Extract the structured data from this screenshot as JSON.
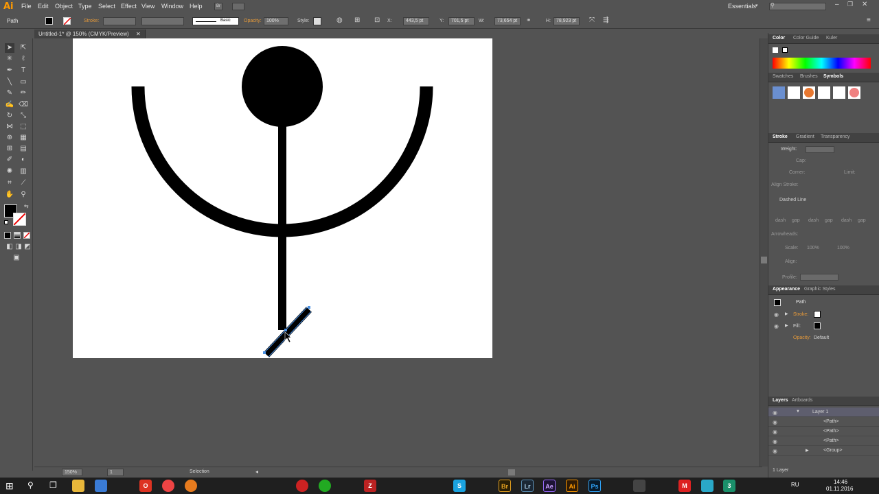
{
  "app": {
    "logo": "Ai",
    "workspace": "Essentials"
  },
  "menu": [
    "File",
    "Edit",
    "Object",
    "Type",
    "Select",
    "Effect",
    "View",
    "Window",
    "Help"
  ],
  "bridge_label": "Br",
  "control": {
    "selection_label": "Path",
    "stroke_label": "Stroke:",
    "brush_label": "Basic",
    "opacity_label": "Opacity:",
    "opacity_value": "100%",
    "style_label": "Style:",
    "x_label": "X:",
    "x_value": "443,5 pt",
    "y_label": "Y:",
    "y_value": "701,5 pt",
    "w_label": "W:",
    "w_value": "73,654 pt",
    "h_label": "H:",
    "h_value": "78,923 pt"
  },
  "document_tab": "Untitled-1* @ 150% (CMYK/Preview)",
  "status": {
    "zoom": "150%",
    "artboard": "1",
    "tool": "Selection"
  },
  "panels": {
    "color_tabs": [
      "Color",
      "Color Guide",
      "Kuler"
    ],
    "symbol_tabs": [
      "Swatches",
      "Brushes",
      "Symbols"
    ],
    "stroke_tabs": [
      "Stroke",
      "Gradient",
      "Transparency"
    ],
    "stroke": {
      "weight": "Weight:",
      "cap": "Cap:",
      "corner": "Corner:",
      "limit": "Limit:",
      "align": "Align Stroke:",
      "dashed": "Dashed Line",
      "dash_labels": [
        "dash",
        "gap",
        "dash",
        "gap",
        "dash",
        "gap"
      ],
      "arrowheads": "Arrowheads:",
      "scale": "Scale:",
      "scale_a": "100%",
      "scale_b": "100%",
      "align2": "Align:",
      "profile": "Profile:"
    },
    "appearance_tabs": [
      "Appearance",
      "Graphic Styles"
    ],
    "appearance": {
      "title": "Path",
      "stroke": "Stroke:",
      "fill": "Fill:",
      "opacity": "Opacity:",
      "opacity_value": "Default"
    },
    "layers_tabs": [
      "Layers",
      "Artboards"
    ],
    "layers": [
      {
        "name": "Layer 1"
      },
      {
        "name": "<Path>"
      },
      {
        "name": "<Path>"
      },
      {
        "name": "<Path>"
      },
      {
        "name": "<Group>"
      }
    ],
    "layers_footer": "1 Layer"
  },
  "taskbar": {
    "apps": [
      "Br",
      "Lr",
      "Ae",
      "Ai",
      "Ps"
    ],
    "lang": "RU",
    "time": "14:46",
    "date": "01.11.2016"
  },
  "colors": {
    "accent": "#ff9a00",
    "selection": "#4a90e2",
    "taskbar": "#1f1f1f"
  }
}
